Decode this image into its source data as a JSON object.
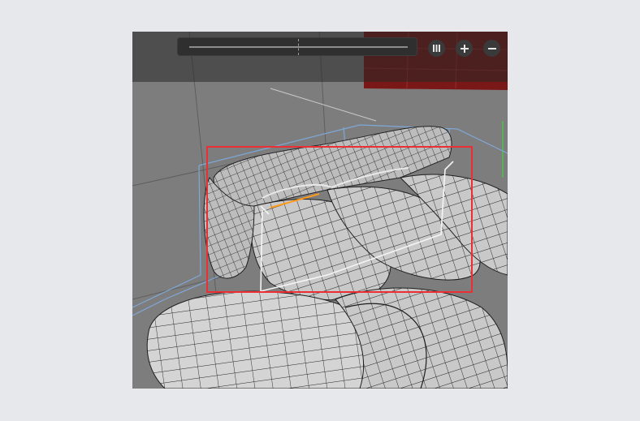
{
  "viewport": {
    "icons": {
      "columns": "three-bars-icon",
      "zoom_in": "plus-icon",
      "zoom_out": "minus-icon"
    },
    "colors": {
      "background": "#7d7d7d",
      "wire_blue": "#7fa8d8",
      "selection": "#ea2f35",
      "red_object": "#7a1818",
      "edge_highlight": "#ff9a1a"
    }
  }
}
